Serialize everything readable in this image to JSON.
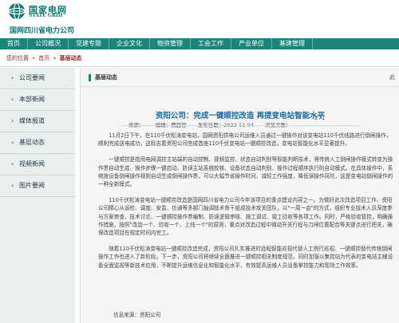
{
  "header": {
    "brand_cn": "国家电网",
    "brand_en": "STATE GRID",
    "company": "国网四川省电力公司"
  },
  "nav": {
    "items": [
      "首页",
      "公司概况",
      "党建专题",
      "企业文化",
      "物资管理",
      "工会工作",
      "产业单位",
      "基建管理"
    ]
  },
  "breadcrumb": {
    "prefix": "您的位置",
    "home": "首页",
    "current": "基层动态"
  },
  "sidebar": {
    "items": [
      "公司要闻",
      "本部新闻",
      "媒体报道",
      "基层动态",
      "视频新闻",
      "图片要闻"
    ]
  },
  "main": {
    "section_label": "基层动态",
    "edge_char": "此",
    "title": "资阳公司：完成一键顺控改造 再提变电站智能水平",
    "meta": {
      "source": "来源：",
      "editor": "编辑：费超容",
      "date": "发布日期：2022-11-04",
      "views_label": "浏览次数：",
      "views": "271"
    },
    "paragraphs": [
      "11月2日下午，在110千伏松涛变电站，国网资阳供电公司运维人员通过一键操作对该变电站110千伏线路进行倒闸操作，顺利完成送电成功，这标志着资阳公司完成首座110千伏变电站一键顺控改造，变电站智能化水平显著提升。",
      "一键顺控是指用电网调控主站端的自动控制、视频监控、状态自动判别等智能判断技术，将传统人工倒闸操作模式转变为操作票自动生成、操作步骤一键启动、防误主站系统校核、设备状态自动判别、操作过程顺序执行的自动模式。在具体操作中，系统按设备倒闸操作规则自动生成倒闸操作票，可以大幅节省操作时间，减轻工作强度，降低误操作风险，这是变电站倒闸操作的一种全新模式。",
      "110千伏松涛变电站一键顺控改造是国网四川省电力公司今年该项目的重点建设内容之一。为做好此次改造项目工作，资阳公司精心从运检、调度、安监、信通等多部门抽调技术骨干组成技术攻关团队，以\"一周一会\"的方式，组织专业技术人员深度参与方案审查、技术讨论、一键顺控操作票编制、防误逻辑审核、施工调试、竣工验收等各项工作。同时，严格验收管控，明确操作措施，按照\"改造一个、验收一个、上线一个\"的原则，重点对改造过程中微动开关行程与刀闸位置配合等关键点进行把关，确保改造项目在规定时间内完工。",
      "随着110千伏松涛变电站一键顺控改造完成，资阳公司扎实推进的远程智能巡视代替人工例行巡视、一键顺控替代传统倒闸操作工作也进入了新阶段。下一步，资阳公司将继续全面推进一键顺控相关制度规范，同时加强以集控站为代表的变电站主辅设备全面监视等新技术应用，不断提升运维信息化和智能化水平，有效提高运维人员设备掌控能力和现场工作效率。"
    ],
    "source_line": "信息来源：资阳公司"
  }
}
